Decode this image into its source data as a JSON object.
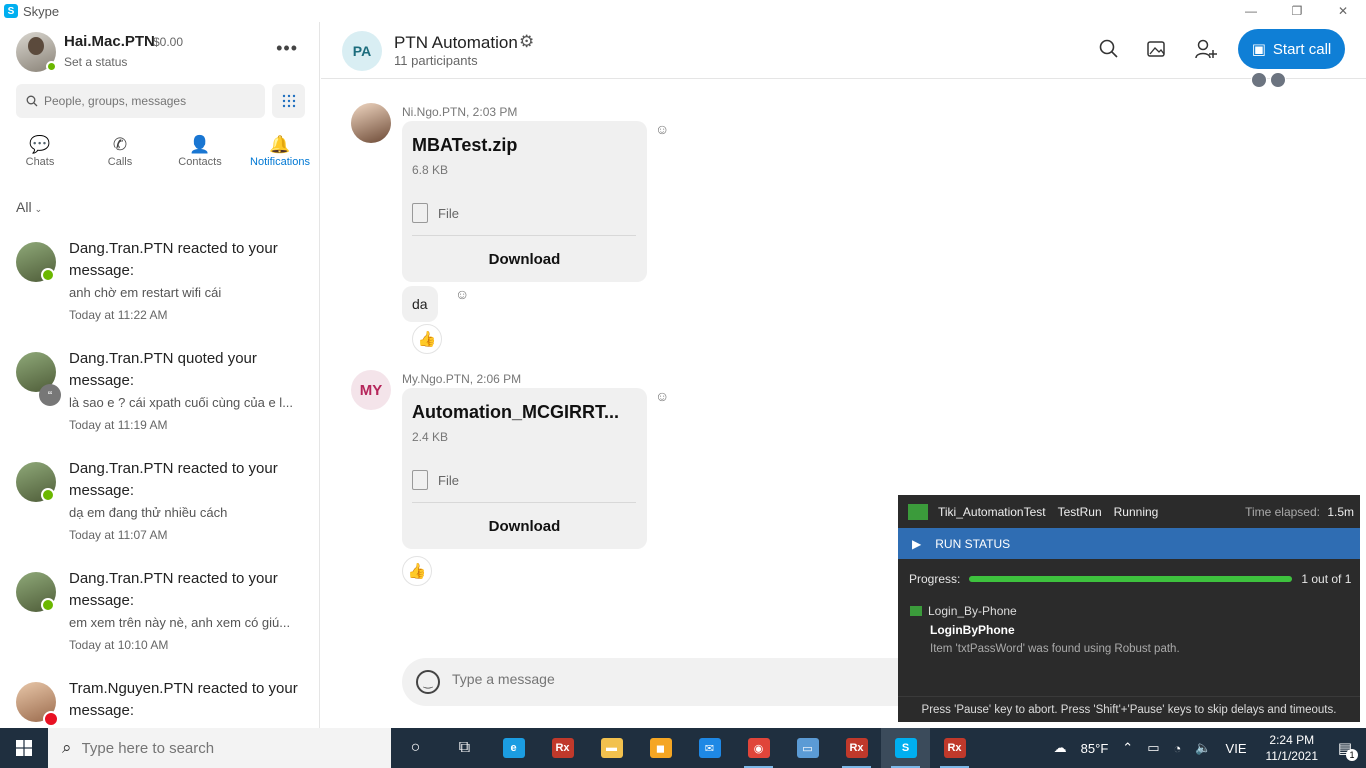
{
  "window": {
    "title": "Skype",
    "logo_letter": "S",
    "controls": [
      "—",
      "❐",
      "✕"
    ]
  },
  "profile": {
    "name": "Hai.Mac.PTN",
    "credit": "$0.00",
    "status": "Set a status",
    "more": "•••"
  },
  "search": {
    "placeholder": "People, groups, messages"
  },
  "nav": {
    "tabs": [
      {
        "label": "Chats",
        "icon": "chat-icon",
        "glyph": "💬"
      },
      {
        "label": "Calls",
        "icon": "phone-icon",
        "glyph": "✆"
      },
      {
        "label": "Contacts",
        "icon": "contacts-icon",
        "glyph": "👤"
      },
      {
        "label": "Notifications",
        "icon": "bell-icon",
        "glyph": "🔔"
      }
    ],
    "active": "Notifications"
  },
  "filter": {
    "label": "All"
  },
  "notifications": [
    {
      "title": "Dang.Tran.PTN reacted to your message:",
      "text": "anh chờ em restart wifi cái",
      "time": "Today at 11:22 AM",
      "badge": "reaction"
    },
    {
      "title": "Dang.Tran.PTN quoted your message:",
      "text": "là sao e ? cái xpath cuối cùng của e l...",
      "time": "Today at 11:19 AM",
      "badge": "quote"
    },
    {
      "title": "Dang.Tran.PTN reacted to your message:",
      "text": "dạ em đang thử nhiều cách",
      "time": "Today at 11:07 AM",
      "badge": "reaction"
    },
    {
      "title": "Dang.Tran.PTN reacted to your message:",
      "text": "em xem trên này nè, anh xem có giú...",
      "time": "Today at 10:10 AM",
      "badge": "reaction"
    },
    {
      "title": "Tram.Nguyen.PTN reacted to your message:",
      "text": "",
      "time": "",
      "badge": "heart"
    }
  ],
  "chat": {
    "initials": "PA",
    "name": "PTN Automation",
    "participants": "11 participants",
    "start_call": "Start call",
    "messages": [
      {
        "sender": "Ni.Ngo.PTN, 2:03 PM",
        "file_name": "MBATest.zip",
        "file_size": "6.8 KB",
        "file_type": "File",
        "download": "Download"
      },
      {
        "text": "da",
        "reaction": "👍"
      },
      {
        "sender": "My.Ngo.PTN, 2:06 PM",
        "initials": "MY",
        "file_name": "Automation_MCGIRRT...",
        "file_size": "2.4 KB",
        "file_type": "File",
        "download": "Download",
        "reaction": "👍"
      }
    ],
    "composer_placeholder": "Type a message"
  },
  "run_panel": {
    "project": "Tiki_AutomationTest",
    "run": "TestRun",
    "state": "Running",
    "elapsed_label": "Time elapsed:",
    "elapsed": "1.5m",
    "status_title": "RUN STATUS",
    "progress_label": "Progress:",
    "progress_fraction": 1.0,
    "progress_count": "1 out of 1",
    "suite": "Login_By-Phone",
    "case": "LoginByPhone",
    "log": "Item 'txtPassWord' was found using Robust path.",
    "footer": "Press 'Pause' key to abort. Press 'Shift'+'Pause' keys to skip delays and timeouts."
  },
  "taskbar": {
    "search_placeholder": "Type here to search",
    "apps": [
      {
        "name": "cortana-icon",
        "glyph": "○"
      },
      {
        "name": "task-view-icon",
        "glyph": "⧉"
      },
      {
        "name": "edge-icon",
        "glyph": "e",
        "color": "#1b9de2"
      },
      {
        "name": "ranorex-icon",
        "glyph": "Rx",
        "color": "#c0392b"
      },
      {
        "name": "file-explorer-icon",
        "glyph": "▬",
        "color": "#f2c14e"
      },
      {
        "name": "store-icon",
        "glyph": "◼",
        "color": "#f5a623"
      },
      {
        "name": "mail-icon",
        "glyph": "✉",
        "color": "#1e88e5"
      },
      {
        "name": "chrome-icon",
        "glyph": "◉",
        "color": "#e0453a",
        "running": true
      },
      {
        "name": "remote-desktop-icon",
        "glyph": "▭",
        "color": "#5b9bd5"
      },
      {
        "name": "ranorex-icon-2",
        "glyph": "Rx",
        "color": "#c0392b",
        "running": true
      },
      {
        "name": "skype-icon",
        "glyph": "S",
        "color": "#00aff0",
        "active": true
      },
      {
        "name": "ranorex-icon-3",
        "glyph": "Rx",
        "color": "#c0392b",
        "running": true
      }
    ],
    "weather": "85°F",
    "language": "VIE",
    "time": "2:24 PM",
    "date": "11/1/2021",
    "notifications_count": "1"
  }
}
